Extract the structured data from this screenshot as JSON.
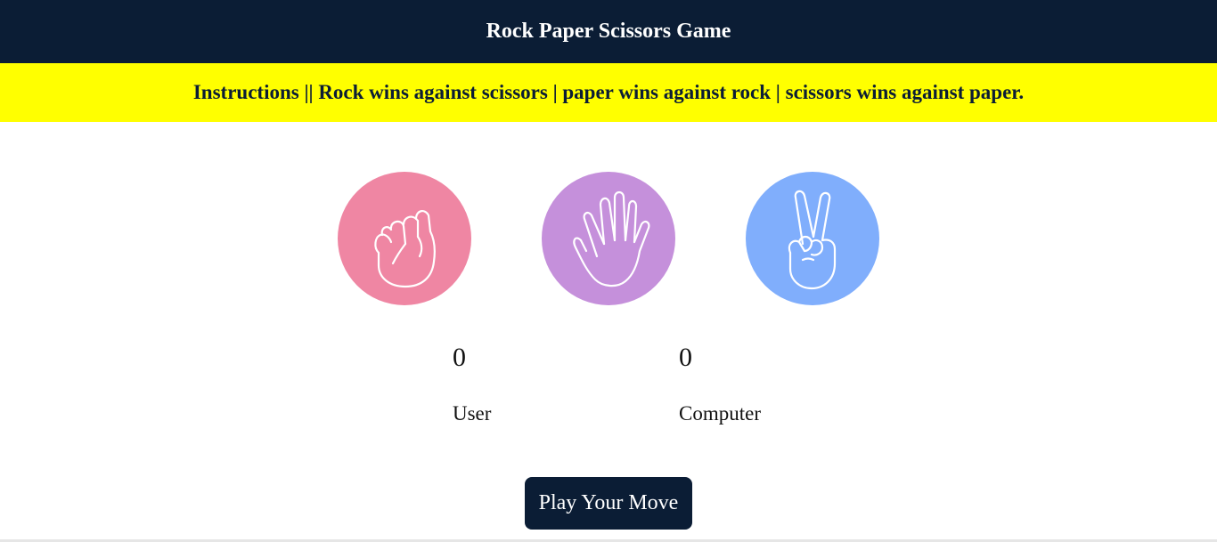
{
  "header": {
    "title": "Rock Paper Scissors Game"
  },
  "instructions": {
    "text": "Instructions || Rock wins against scissors | paper wins against rock | scissors wins against paper."
  },
  "choices": [
    {
      "name": "rock",
      "icon": "fist-icon",
      "color": "#ef86a3"
    },
    {
      "name": "paper",
      "icon": "open-hand-icon",
      "color": "#c590db"
    },
    {
      "name": "scissors",
      "icon": "peace-hand-icon",
      "color": "#80aefc"
    }
  ],
  "scores": {
    "user": {
      "value": "0",
      "label": "User"
    },
    "computer": {
      "value": "0",
      "label": "Computer"
    }
  },
  "play_button": {
    "label": "Play Your Move"
  },
  "colors": {
    "header_bg": "#0b1d35",
    "instructions_bg": "#ffff00",
    "button_bg": "#0b1d35"
  }
}
